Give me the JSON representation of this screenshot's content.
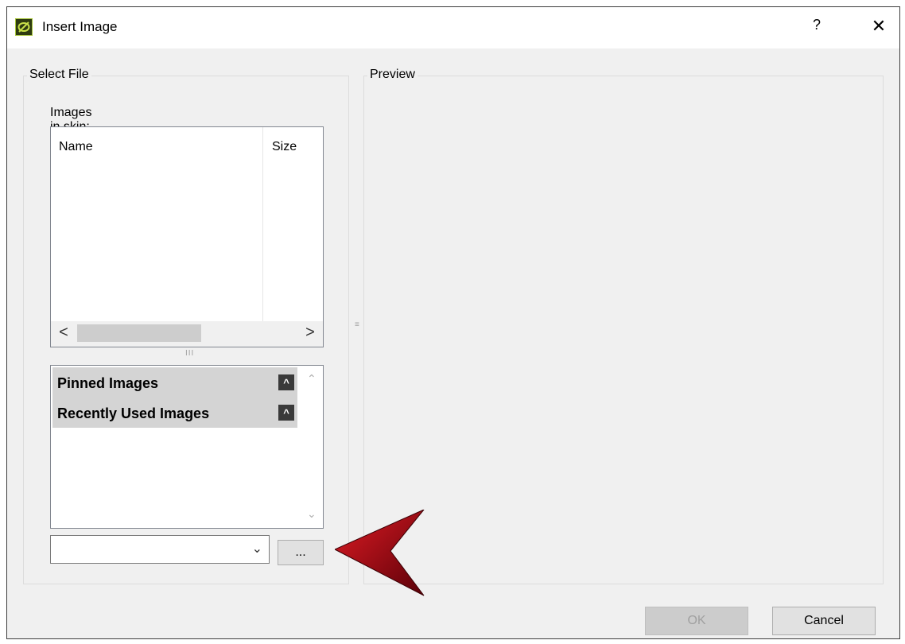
{
  "window": {
    "title": "Insert Image",
    "help_label": "?",
    "close_label": "✕"
  },
  "select_file": {
    "group_title": "Select File",
    "images_label": "Images in skin:",
    "columns": [
      "Name",
      "Size"
    ],
    "scroll_left": "<",
    "scroll_right": ">",
    "pinned_sections": [
      {
        "label": "Pinned Images",
        "toggle": "^"
      },
      {
        "label": "Recently Used Images",
        "toggle": "^"
      }
    ],
    "file_combo_value": "",
    "browse_label": "..."
  },
  "preview": {
    "group_title": "Preview"
  },
  "footer": {
    "ok_label": "OK",
    "cancel_label": "Cancel"
  },
  "colors": {
    "dialog_bg": "#f0f0f0",
    "section_header_bg": "#d4d4d4",
    "arrow_red": "#c0141e"
  }
}
